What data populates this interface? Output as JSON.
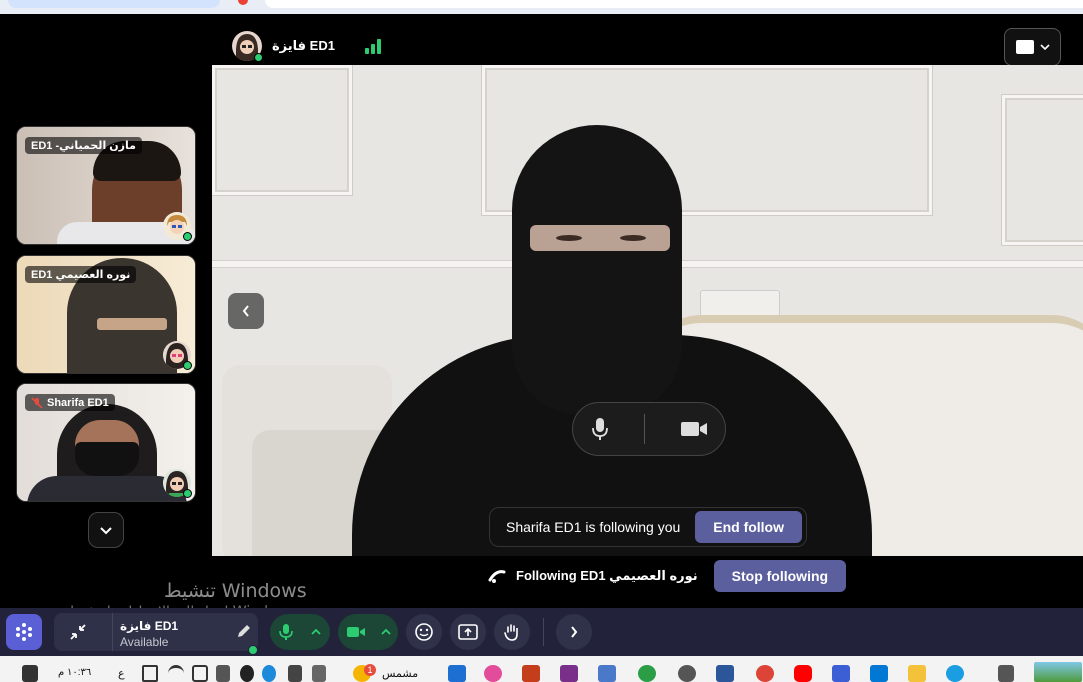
{
  "app": {
    "active_speaker_name": "فايزة ED1",
    "view_button": "layout"
  },
  "tiles": [
    {
      "name": "ED1 -مازن الحمياني",
      "muted": false
    },
    {
      "name": "ED1 نوره العصيمي",
      "muted": false
    },
    {
      "name": "Sharifa ED1",
      "muted": true
    }
  ],
  "main_video": {
    "follow_banner_text": "Sharifa ED1 is following you",
    "end_follow_label": "End follow",
    "following_text": "Following ED1 نوره العصيمي",
    "stop_following_label": "Stop following"
  },
  "watermark": {
    "title": "تنشيط Windows",
    "subtitle": "انتقل إلى الإعدادات لتنشيط Windows."
  },
  "toolbar": {
    "user_name": "فايزة ED1",
    "user_status": "Available"
  },
  "taskbar": {
    "clock_time": "١٠:٣٦ م",
    "lang": "ع",
    "weather_label": "مشمس",
    "notification_count": "1",
    "icons": [
      "system-icon",
      "volume-icon",
      "wifi-icon",
      "battery-icon",
      "chrome-icon",
      "youtube-icon",
      "word-icon",
      "settings-icon",
      "onedrive-icon",
      "powerpoint-icon",
      "edge-icon",
      "folder-icon",
      "outlook-icon",
      "copilot-icon"
    ]
  },
  "colors": {
    "accent_purple": "#5b5f9e",
    "online_green": "#2ecc71",
    "toolbar_bg": "#22233a"
  }
}
